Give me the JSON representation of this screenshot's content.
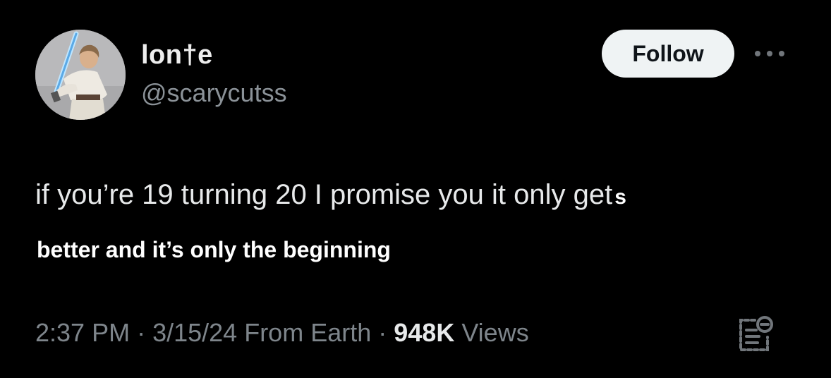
{
  "author": {
    "display_name": "lon†e",
    "handle": "@scarycutss",
    "avatar_icon": "avatar-lightsaber-icon"
  },
  "follow_button": {
    "label": "Follow"
  },
  "more_menu": {
    "icon": "more-horizontal-icon"
  },
  "tweet": {
    "text_main": "if you’re 19 turning 20 I promise you it only get",
    "text_tail": "s",
    "text_overlay": "better and it’s only the beginning"
  },
  "meta": {
    "time": "2:37 PM",
    "separator_1": " · ",
    "date": "3/15/24",
    "source": " From Earth",
    "separator_2": " · ",
    "views_count": "948K",
    "views_label": " Views"
  },
  "notes_button": {
    "icon": "community-notes-icon"
  },
  "colors": {
    "background": "#000000",
    "text_primary": "#e7e9ea",
    "text_secondary": "#7e858b",
    "follow_bg": "#eff3f4",
    "follow_text": "#0f1419"
  }
}
